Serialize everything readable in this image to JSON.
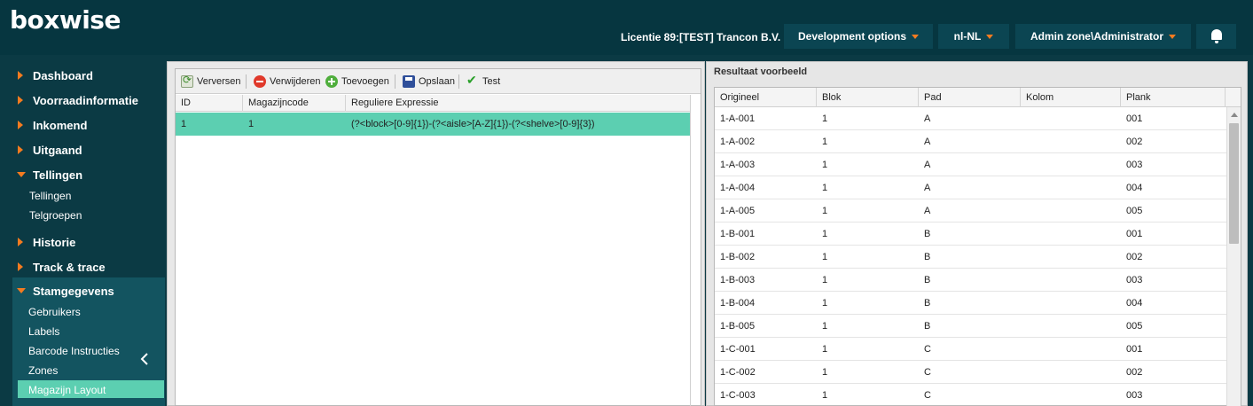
{
  "app": {
    "logo": "boxwise"
  },
  "header": {
    "license": "Licentie 89:[TEST] Trancon B.V.",
    "dev_options": "Development options",
    "language": "nl-NL",
    "user": "Admin zone\\Administrator",
    "notification_icon": "bell-icon"
  },
  "sidebar": {
    "sections": [
      {
        "label": "Dashboard",
        "expanded": false
      },
      {
        "label": "Voorraadinformatie",
        "expanded": false
      },
      {
        "label": "Inkomend",
        "expanded": false
      },
      {
        "label": "Uitgaand",
        "expanded": false
      },
      {
        "label": "Tellingen",
        "expanded": true
      },
      {
        "label": "Historie",
        "expanded": false
      },
      {
        "label": "Track & trace",
        "expanded": false
      },
      {
        "label": "Stamgegevens",
        "expanded": true
      }
    ],
    "tellingen_items": [
      "Tellingen",
      "Telgroepen"
    ],
    "stam_items": [
      "Gebruikers",
      "Labels",
      "Barcode Instructies",
      "Zones",
      "Magazijn Layout"
    ],
    "active_item": "Magazijn Layout",
    "collapse_icon": "chevron-left-icon",
    "accent_color": "#f47b20",
    "active_color": "#5ccfb1"
  },
  "toolbar": {
    "refresh": "Verversen",
    "delete": "Verwijderen",
    "add": "Toevoegen",
    "save": "Opslaan",
    "test": "Test"
  },
  "left_grid": {
    "headers": [
      "ID",
      "Magazijncode",
      "Reguliere Expressie"
    ],
    "rows": [
      [
        "1",
        "1",
        "(?<block>[0-9]{1})-(?<aisle>[A-Z]{1})-(?<shelve>[0-9]{3})"
      ]
    ]
  },
  "right_panel": {
    "title": "Resultaat voorbeeld",
    "headers": [
      "Origineel",
      "Blok",
      "Pad",
      "Kolom",
      "Plank"
    ],
    "rows": [
      [
        "1-A-001",
        "1",
        "A",
        "",
        "001"
      ],
      [
        "1-A-002",
        "1",
        "A",
        "",
        "002"
      ],
      [
        "1-A-003",
        "1",
        "A",
        "",
        "003"
      ],
      [
        "1-A-004",
        "1",
        "A",
        "",
        "004"
      ],
      [
        "1-A-005",
        "1",
        "A",
        "",
        "005"
      ],
      [
        "1-B-001",
        "1",
        "B",
        "",
        "001"
      ],
      [
        "1-B-002",
        "1",
        "B",
        "",
        "002"
      ],
      [
        "1-B-003",
        "1",
        "B",
        "",
        "003"
      ],
      [
        "1-B-004",
        "1",
        "B",
        "",
        "004"
      ],
      [
        "1-B-005",
        "1",
        "B",
        "",
        "005"
      ],
      [
        "1-C-001",
        "1",
        "C",
        "",
        "001"
      ],
      [
        "1-C-002",
        "1",
        "C",
        "",
        "002"
      ],
      [
        "1-C-003",
        "1",
        "C",
        "",
        "003"
      ]
    ]
  }
}
